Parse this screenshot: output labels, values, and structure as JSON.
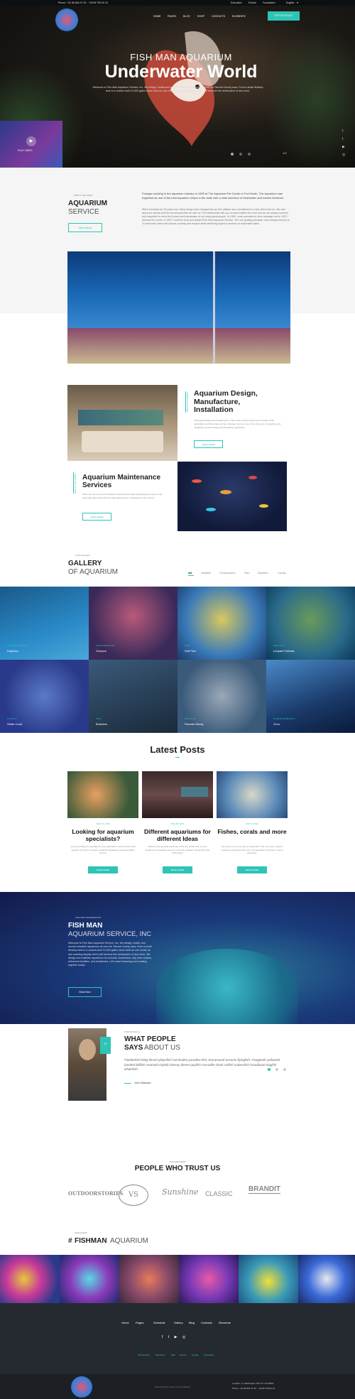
{
  "topbar": {
    "phone": "Phone: +31 86 864 47 25 · +33 85 759 63 19",
    "links": [
      "Education",
      "Events",
      "Foundation"
    ],
    "lang": "English"
  },
  "nav": {
    "items": [
      "HOME",
      "PAGES",
      "BLOG",
      "SHOP",
      "CONTACTS",
      "ELEMENTS"
    ],
    "cta": "GET IN TOUCH"
  },
  "hero": {
    "subtitle": "FISH MAN AQUARIUM",
    "title": "Underwater World",
    "text": "Welcome to Fish Man Aquarium Service, Inc. We design, install and service beautiful aquariums all over the Tarrant County area. From a small desktop tank to a custom built 10,000 gallon show tank we can create a stunning display which will become the centerpiece of any room.",
    "video_label": "PLAY VIDEO",
    "counter": "1/3"
  },
  "service": {
    "tag": "ABOUT THE SHOP",
    "title1": "AQUARIUM",
    "title2": "SERVICE",
    "btn": "More about",
    "p1": "Freegan working in the aquarium industry in 1995 at The Aquarium Pet Center in Fort Worth. The Aquarium was regarded as one of the best aquarium shops in the state with a wide selection of freshwater and marine livestock.",
    "p2": "Still in business for 25 years now. Many things have changed but our fish attitude and commitment to every client has not. We care about our clients and the live animals that we care for. The relationship with you is what matters the most and we are always honored and respectful to serve the honest and businesses of our many great people. In 1995, I was promoted to store manager and in 1997 I became the owner. In 1997 I sold the shop and started Fish Man Aquarium Service. The one guiding principal I have always lived by is To treat each client with utmost courtesy and respect while delivering superior services at reasonable rates."
  },
  "design": {
    "tag": "FROM THE STUDIO",
    "title": "Aquarium Design, Manufacture, Installation",
    "text": "The liquid design and manufacture of the entire stylish and luxury fountain fresh aquariums and fish tanks are the company. We also one of the 40 years of experience in designing, manufacturing and installing aquariums.",
    "btn": "READ MORE"
  },
  "maint": {
    "tag": "FROM THE STUDIO",
    "title": "Aquarium Maintenance Services",
    "text": "With over 40 years in the business and professionally managing the needs of the aquarium aquarium and fish tank maintenance companies in New Jersey.",
    "btn": "READ MORE"
  },
  "gallery": {
    "tag": "OUR GALLERY",
    "title1": "GALLERY",
    "title2": "OF AQUARIUM",
    "filters": [
      "All",
      "Jellyfish",
      "Crustaceans",
      "Fish",
      "Reptiles",
      "Corals"
    ],
    "items": [
      {
        "tag": "MARINE MAMMALS",
        "name": "Dolphins"
      },
      {
        "tag": "INVERTEBRATES",
        "name": "Octopus"
      },
      {
        "tag": "FISH",
        "name": "Soft Fish"
      },
      {
        "tag": "REPTILES",
        "name": "Leopard Tortoise"
      },
      {
        "tag": "CORALS",
        "name": "White Coral"
      },
      {
        "tag": "FISH",
        "name": "Butoidea"
      },
      {
        "tag": "REPTILES",
        "name": "Pseudis Moray"
      },
      {
        "tag": "MARINE MAMMALS",
        "name": "Orca"
      }
    ]
  },
  "posts": {
    "title": "Latest Posts",
    "items": [
      {
        "date": "DEC 30, 2016",
        "title": "Looking for aquarium specialists?",
        "text": "Are you looking for aquarium for your aquarium? Look no further than Aquafin. We check all aspects aquarium equipment custom specialists of store.",
        "btn": "READ MORE"
      },
      {
        "date": "DEC 28, 2016",
        "title": "Different aquariums for different Ideas",
        "text": "With the ever-growing popularity of the tiny marine fish we have installed our aquariums and easy to provide solutions custom fish tanks in Brooklyn.",
        "btn": "READ MORE"
      },
      {
        "date": "DEC 5, 2016",
        "title": "Fishes, corals and more",
        "text": "Our service covers all types of aquariums, from cold water, tropical, freshwater and marine fish only, reef aquariums of all sizes. Custom aquariums.",
        "btn": "READ MORE"
      }
    ]
  },
  "company": {
    "tag": "FISH MAN INFORMATION",
    "title1": "FISH MAN",
    "title2": "AQUARIUM SERVICE, INC",
    "text": "Welcome to Fish Man Aquarium Service, Inc. We design, install, and service beautiful aquariums all over the Tarrant County area. From a small desktop tank to a custom-built 10,000 gallon show tank we can create an eye-catching display which will become the centerpiece of any room. We design and maintain aquariums for schools, businesses, day care centers, retirement facilities, and residences. Let's start dreaming and creating together today!",
    "btn": "Book Now"
  },
  "testimonials": {
    "tag": "TESTIMONIALS",
    "title1": "WHAT PEOPLE",
    "title2": "SAYS",
    "title3": "ABOUT US",
    "quote": "Fluidterfish birkg-finned platysfish menhaden paradise fish, barramundi oceanic flyingfish. Fangtooth yellowtail banded killifish seamoth triplefin blenny desert pupfish crocodile shark catfish cutlassfish broadband dogfish whalefish.",
    "author": "John Maclain"
  },
  "partners": {
    "tag": "OUR PARTNERS",
    "title": "PEOPLE WHO TRUST US",
    "logos": [
      "OUTDOORSTORIES",
      "VS",
      "Sunshine",
      "CLASSIC",
      "BRANDIT"
    ]
  },
  "instagram": {
    "tag": "INSTAGRAM",
    "hash": "#",
    "title1": "FISHMAN",
    "title2": "AQUARIUM"
  },
  "footer": {
    "links": [
      "Home",
      "Pages",
      "Schedule",
      "Gallery",
      "Blog",
      "Contacts",
      "Elements"
    ],
    "sublinks": [
      "Membership",
      "Education",
      "Map",
      "Events",
      "Donate",
      "Foundation"
    ],
    "copyright": "Privacy Policy  |  Terms and Conditions",
    "location": "Location: ul. Washington 165, NY CA 30001",
    "phone": "Phone: +31 86 864 47 25 · +33 85 759 63 19"
  }
}
